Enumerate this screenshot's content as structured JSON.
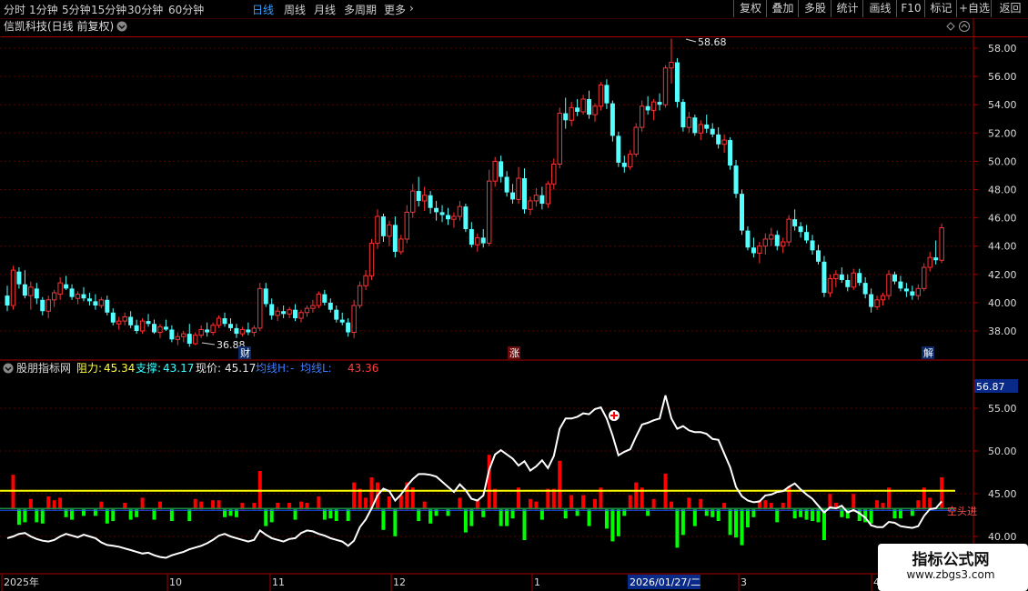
{
  "toolbar": {
    "periods": [
      "分时",
      "1分钟",
      "5分钟",
      "15分钟",
      "30分钟",
      "60分钟",
      "日线",
      "周线",
      "月线",
      "多周期",
      "更多"
    ],
    "active_period": "日线",
    "right_buttons": [
      "复权",
      "叠加",
      "多股",
      "统计",
      "画线",
      "F10",
      "标记",
      "+自选",
      "返回"
    ]
  },
  "main_chart": {
    "title": "信凯科技(日线 前复权)",
    "high_label": "58.68",
    "low_label": "36.88",
    "markers": [
      "财",
      "涨",
      "解"
    ],
    "y_ticks": [
      "58.00",
      "56.00",
      "54.00",
      "52.00",
      "50.00",
      "48.00",
      "46.00",
      "44.00",
      "42.00",
      "40.00",
      "38.00"
    ]
  },
  "indicator": {
    "name": "股朋指标网",
    "resist_label": "阻力:",
    "resist_value": "45.34",
    "support_label": "支撑:",
    "support_value": "43.17",
    "price_label": "现价:",
    "price_value": "45.17",
    "ma_h_label": "均线H:",
    "ma_h_value": "-",
    "ma_l_label": "均线L:",
    "ma_l_value": "43.36",
    "top_value": "56.87",
    "y_ticks": [
      "55.00",
      "50.00",
      "45.00",
      "40.00"
    ],
    "side_text": "空头进"
  },
  "x_axis": {
    "labels": [
      "2025年",
      "10",
      "11",
      "12",
      "1",
      "3",
      "4"
    ],
    "cursor_date": "2026/01/27/二"
  },
  "watermark": {
    "title": "指标公式网",
    "url": "www.zbgs3.com"
  },
  "colors": {
    "up": "#ff3232",
    "down": "#54ffff",
    "bg": "#000000",
    "border": "#aa0000",
    "resist_line": "#ffff00",
    "support_line": "#00ffff",
    "line_white": "#ffffff",
    "bar_red": "#ff0000",
    "bar_green": "#00ff00"
  },
  "chart_data": {
    "type": "candlestick",
    "price_range": [
      36.88,
      58.68
    ],
    "ohlc": [
      [
        40.5,
        41.2,
        39.4,
        39.8
      ],
      [
        39.8,
        42.6,
        39.5,
        42.3
      ],
      [
        42.2,
        42.5,
        41.0,
        41.3
      ],
      [
        41.3,
        42.3,
        40.3,
        40.5
      ],
      [
        40.5,
        41.5,
        39.5,
        41.1
      ],
      [
        41.0,
        41.4,
        39.9,
        40.3
      ],
      [
        40.2,
        40.4,
        39.1,
        39.4
      ],
      [
        39.4,
        40.5,
        38.9,
        40.2
      ],
      [
        40.2,
        40.9,
        39.7,
        40.7
      ],
      [
        40.6,
        41.8,
        40.2,
        41.4
      ],
      [
        41.3,
        41.9,
        40.9,
        41.0
      ],
      [
        41.0,
        41.3,
        40.2,
        40.4
      ],
      [
        40.3,
        40.8,
        39.9,
        40.6
      ],
      [
        40.6,
        41.1,
        40.1,
        40.3
      ],
      [
        40.3,
        40.7,
        39.8,
        40.1
      ],
      [
        40.1,
        40.6,
        39.5,
        39.8
      ],
      [
        39.8,
        40.4,
        39.6,
        40.2
      ],
      [
        40.2,
        40.5,
        39.1,
        39.3
      ],
      [
        39.3,
        39.6,
        38.4,
        38.6
      ],
      [
        38.5,
        39.0,
        38.1,
        38.7
      ],
      [
        38.7,
        39.3,
        38.4,
        39.0
      ],
      [
        39.0,
        39.4,
        38.2,
        38.4
      ],
      [
        38.4,
        38.8,
        37.8,
        38.0
      ],
      [
        38.0,
        38.9,
        37.8,
        38.7
      ],
      [
        38.7,
        39.2,
        38.3,
        38.5
      ],
      [
        38.5,
        38.8,
        37.8,
        37.9
      ],
      [
        37.9,
        38.5,
        37.5,
        38.3
      ],
      [
        38.3,
        38.8,
        38.0,
        38.1
      ],
      [
        38.1,
        38.4,
        37.2,
        37.4
      ],
      [
        37.4,
        37.9,
        37.0,
        37.6
      ],
      [
        37.6,
        38.0,
        37.2,
        37.8
      ],
      [
        37.8,
        38.5,
        36.88,
        37.1
      ],
      [
        37.1,
        37.9,
        37.0,
        37.7
      ],
      [
        37.7,
        38.4,
        37.5,
        38.1
      ],
      [
        38.1,
        38.6,
        37.6,
        37.9
      ],
      [
        37.9,
        38.6,
        37.7,
        38.4
      ],
      [
        38.4,
        39.1,
        38.2,
        38.9
      ],
      [
        38.9,
        39.3,
        38.3,
        38.5
      ],
      [
        38.5,
        38.9,
        38.0,
        38.2
      ],
      [
        38.2,
        38.5,
        37.5,
        37.8
      ],
      [
        37.8,
        38.3,
        37.6,
        38.1
      ],
      [
        38.1,
        38.6,
        37.7,
        37.9
      ],
      [
        37.9,
        38.4,
        37.6,
        38.2
      ],
      [
        38.2,
        41.4,
        38.0,
        41.0
      ],
      [
        41.0,
        41.4,
        39.7,
        39.9
      ],
      [
        39.9,
        40.3,
        38.8,
        39.1
      ],
      [
        39.1,
        39.7,
        38.7,
        39.4
      ],
      [
        39.4,
        39.8,
        38.9,
        39.2
      ],
      [
        39.2,
        39.7,
        38.9,
        39.5
      ],
      [
        39.5,
        39.9,
        38.7,
        38.9
      ],
      [
        38.9,
        39.5,
        38.6,
        39.3
      ],
      [
        39.3,
        39.8,
        39.0,
        39.6
      ],
      [
        39.6,
        40.2,
        39.3,
        39.8
      ],
      [
        39.8,
        40.8,
        39.6,
        40.6
      ],
      [
        40.6,
        40.9,
        39.8,
        40.0
      ],
      [
        40.0,
        40.3,
        39.3,
        39.5
      ],
      [
        39.5,
        39.8,
        38.6,
        38.8
      ],
      [
        38.8,
        39.3,
        38.4,
        38.6
      ],
      [
        38.6,
        38.9,
        37.6,
        37.9
      ],
      [
        37.9,
        40.2,
        37.5,
        39.8
      ],
      [
        39.8,
        41.5,
        39.6,
        41.2
      ],
      [
        41.2,
        42.3,
        40.9,
        41.9
      ],
      [
        41.9,
        44.5,
        41.6,
        44.2
      ],
      [
        44.2,
        46.6,
        43.8,
        46.1
      ],
      [
        46.1,
        46.3,
        44.3,
        44.7
      ],
      [
        44.7,
        45.8,
        44.0,
        45.5
      ],
      [
        45.5,
        46.1,
        43.2,
        43.6
      ],
      [
        43.6,
        44.8,
        43.4,
        44.5
      ],
      [
        44.5,
        46.9,
        44.2,
        46.4
      ],
      [
        46.4,
        48.4,
        46.0,
        47.9
      ],
      [
        47.9,
        48.9,
        46.8,
        47.2
      ],
      [
        47.2,
        48.2,
        46.5,
        47.6
      ],
      [
        47.6,
        47.9,
        46.3,
        46.7
      ],
      [
        46.7,
        47.2,
        45.8,
        46.4
      ],
      [
        46.4,
        46.9,
        45.7,
        46.2
      ],
      [
        46.2,
        46.7,
        45.5,
        45.9
      ],
      [
        45.9,
        46.4,
        45.3,
        46.1
      ],
      [
        46.1,
        47.2,
        45.8,
        46.8
      ],
      [
        46.8,
        47.0,
        45.0,
        45.2
      ],
      [
        45.2,
        45.7,
        43.9,
        44.1
      ],
      [
        44.1,
        44.9,
        43.6,
        44.6
      ],
      [
        44.6,
        45.2,
        43.9,
        44.2
      ],
      [
        44.2,
        49.4,
        44.0,
        48.6
      ],
      [
        48.6,
        50.3,
        48.2,
        50.0
      ],
      [
        50.0,
        50.4,
        48.5,
        48.9
      ],
      [
        48.9,
        49.3,
        47.5,
        47.8
      ],
      [
        47.8,
        48.4,
        47.0,
        47.3
      ],
      [
        47.3,
        49.6,
        47.0,
        48.8
      ],
      [
        48.8,
        49.5,
        46.3,
        46.6
      ],
      [
        46.6,
        47.5,
        46.2,
        47.2
      ],
      [
        47.2,
        48.1,
        46.8,
        47.6
      ],
      [
        47.6,
        48.2,
        46.6,
        47.0
      ],
      [
        47.0,
        48.6,
        46.7,
        48.4
      ],
      [
        48.4,
        50.2,
        48.0,
        49.8
      ],
      [
        49.8,
        53.8,
        49.5,
        53.4
      ],
      [
        53.4,
        54.5,
        52.3,
        52.9
      ],
      [
        52.9,
        54.2,
        52.5,
        53.8
      ],
      [
        53.8,
        54.4,
        53.2,
        53.5
      ],
      [
        53.5,
        54.7,
        53.3,
        54.4
      ],
      [
        54.4,
        55.0,
        53.0,
        53.3
      ],
      [
        53.3,
        54.1,
        52.8,
        53.9
      ],
      [
        53.9,
        55.6,
        53.6,
        55.4
      ],
      [
        55.4,
        55.8,
        53.7,
        54.1
      ],
      [
        54.1,
        54.3,
        51.4,
        51.8
      ],
      [
        51.8,
        52.1,
        49.6,
        49.9
      ],
      [
        49.9,
        50.4,
        49.2,
        49.6
      ],
      [
        49.6,
        50.8,
        49.4,
        50.5
      ],
      [
        50.5,
        52.7,
        50.3,
        52.4
      ],
      [
        52.4,
        54.3,
        52.1,
        53.9
      ],
      [
        53.9,
        54.6,
        53.3,
        53.6
      ],
      [
        53.6,
        54.4,
        52.9,
        54.2
      ],
      [
        54.2,
        54.8,
        53.6,
        54.0
      ],
      [
        54.0,
        56.8,
        53.8,
        56.6
      ],
      [
        56.6,
        58.68,
        55.5,
        57.0
      ],
      [
        57.0,
        57.3,
        53.8,
        54.2
      ],
      [
        54.2,
        54.4,
        52.1,
        52.4
      ],
      [
        52.4,
        53.5,
        52.0,
        53.1
      ],
      [
        53.1,
        53.3,
        51.8,
        52.0
      ],
      [
        52.0,
        52.9,
        51.5,
        52.6
      ],
      [
        52.6,
        53.3,
        52.0,
        52.3
      ],
      [
        52.3,
        52.7,
        51.7,
        51.9
      ],
      [
        51.9,
        52.4,
        50.9,
        51.2
      ],
      [
        51.2,
        51.9,
        50.6,
        51.5
      ],
      [
        51.5,
        51.7,
        49.4,
        49.7
      ],
      [
        49.7,
        50.1,
        47.4,
        47.7
      ],
      [
        47.7,
        48.0,
        44.8,
        45.1
      ],
      [
        45.1,
        45.4,
        43.7,
        43.9
      ],
      [
        43.9,
        44.6,
        43.2,
        43.5
      ],
      [
        43.5,
        44.3,
        42.8,
        44.0
      ],
      [
        44.0,
        44.9,
        43.4,
        44.5
      ],
      [
        44.5,
        45.3,
        44.0,
        44.8
      ],
      [
        44.8,
        45.1,
        43.7,
        44.0
      ],
      [
        44.0,
        44.6,
        43.5,
        44.3
      ],
      [
        44.3,
        46.2,
        44.0,
        45.9
      ],
      [
        45.9,
        46.6,
        45.1,
        45.4
      ],
      [
        45.4,
        45.7,
        44.6,
        45.0
      ],
      [
        45.0,
        45.5,
        44.2,
        44.4
      ],
      [
        44.4,
        44.8,
        43.4,
        43.7
      ],
      [
        43.7,
        44.1,
        42.7,
        42.9
      ],
      [
        42.9,
        43.3,
        40.4,
        40.7
      ],
      [
        40.7,
        42.0,
        40.4,
        41.7
      ],
      [
        41.7,
        42.3,
        41.1,
        42.0
      ],
      [
        42.0,
        42.5,
        41.4,
        41.6
      ],
      [
        41.6,
        42.0,
        40.8,
        41.1
      ],
      [
        41.1,
        42.4,
        40.9,
        42.1
      ],
      [
        42.1,
        42.4,
        41.2,
        41.4
      ],
      [
        41.4,
        41.8,
        40.3,
        40.6
      ],
      [
        40.6,
        41.0,
        39.3,
        39.7
      ],
      [
        39.7,
        40.5,
        39.5,
        40.2
      ],
      [
        40.2,
        40.7,
        39.8,
        40.5
      ],
      [
        40.5,
        42.3,
        40.2,
        42.0
      ],
      [
        42.0,
        42.2,
        41.3,
        41.5
      ],
      [
        41.5,
        41.9,
        40.8,
        41.0
      ],
      [
        41.0,
        41.4,
        40.4,
        40.8
      ],
      [
        40.8,
        41.2,
        40.2,
        40.5
      ],
      [
        40.5,
        41.3,
        40.2,
        41.0
      ],
      [
        41.0,
        42.8,
        40.8,
        42.5
      ],
      [
        42.5,
        43.6,
        42.2,
        43.2
      ],
      [
        43.2,
        44.4,
        42.7,
        43.0
      ],
      [
        43.0,
        45.6,
        42.8,
        45.3
      ]
    ],
    "indicator_line": [
      39.8,
      40.0,
      40.3,
      40.4,
      40.0,
      39.7,
      39.5,
      39.4,
      39.6,
      40.0,
      40.3,
      40.1,
      39.9,
      40.2,
      40.0,
      39.8,
      39.3,
      39.0,
      38.9,
      38.8,
      38.6,
      38.4,
      38.2,
      38.0,
      38.1,
      37.8,
      37.6,
      37.5,
      37.8,
      38.0,
      38.2,
      38.5,
      38.7,
      38.9,
      39.2,
      39.6,
      40.1,
      40.3,
      40.0,
      39.8,
      39.6,
      39.4,
      39.6,
      40.7,
      40.2,
      39.8,
      39.6,
      39.4,
      39.7,
      39.8,
      40.4,
      40.7,
      40.6,
      40.3,
      40.1,
      39.8,
      39.6,
      39.4,
      38.9,
      39.5,
      41.1,
      42.0,
      43.3,
      44.8,
      45.6,
      45.3,
      44.2,
      44.9,
      45.9,
      46.7,
      47.3,
      47.3,
      47.2,
      47.0,
      46.4,
      45.8,
      45.2,
      46.1,
      45.4,
      44.4,
      44.2,
      44.8,
      47.8,
      49.6,
      50.1,
      49.6,
      49.1,
      48.3,
      48.8,
      47.7,
      48.2,
      48.9,
      48.0,
      49.4,
      52.6,
      53.8,
      53.8,
      54.0,
      54.4,
      54.3,
      54.9,
      55.1,
      53.8,
      51.8,
      49.5,
      49.9,
      50.2,
      51.7,
      53.1,
      53.3,
      53.6,
      53.8,
      56.5,
      53.8,
      52.6,
      52.9,
      52.4,
      52.2,
      52.2,
      52.0,
      51.4,
      51.3,
      49.7,
      48.1,
      45.8,
      44.7,
      44.2,
      44.0,
      44.1,
      44.8,
      44.9,
      45.2,
      45.3,
      45.8,
      46.2,
      45.5,
      44.9,
      44.4,
      43.6,
      42.8,
      43.4,
      43.3,
      43.6,
      42.8,
      43.1,
      42.7,
      42.2,
      41.3,
      41.1,
      41.1,
      41.7,
      41.6,
      41.2,
      41.1,
      41.0,
      41.2,
      42.4,
      43.2,
      43.3,
      44.1
    ],
    "resist": 45.34,
    "support": 43.17,
    "ma_l": 43.36,
    "indicator_range": [
      40.0,
      56.87
    ]
  }
}
